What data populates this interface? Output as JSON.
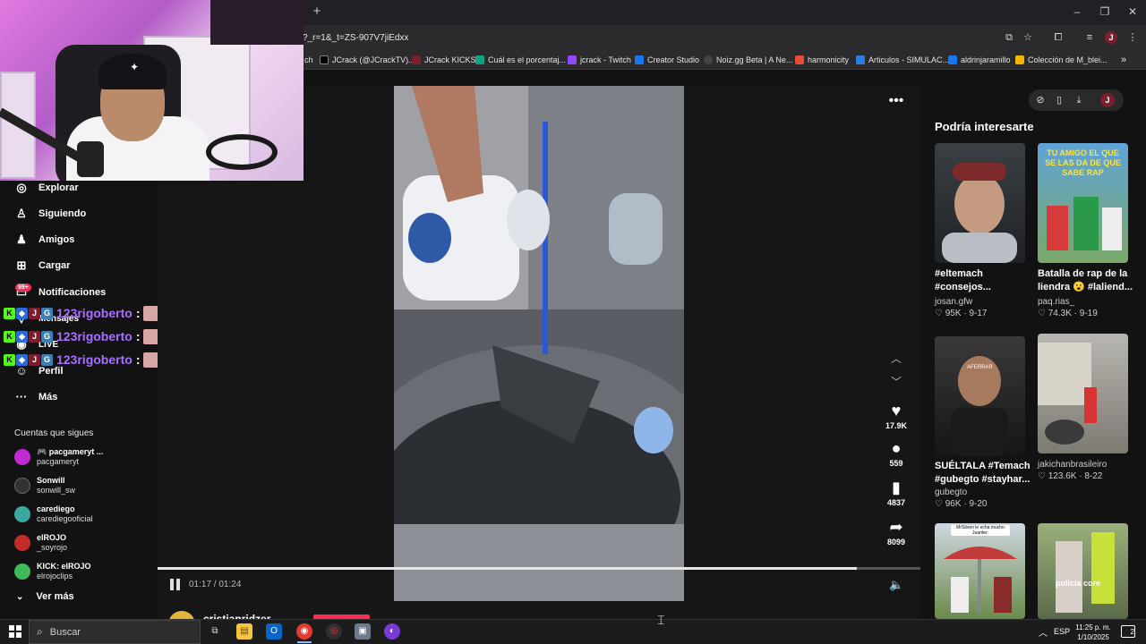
{
  "browser": {
    "new_tab": "+",
    "url": "?_r=1&_t=ZS-907V7jiEdxx",
    "window_controls": [
      "–",
      "❐",
      "✕"
    ],
    "bookmarks": [
      {
        "label": "ch",
        "color": "#000000"
      },
      {
        "label": "JCrack (@JCrackTV)...",
        "color": "#000000"
      },
      {
        "label": "JCrack KICKS",
        "color": "#7b1f2d"
      },
      {
        "label": "Cuál es el porcentaj...",
        "color": "#10a37f"
      },
      {
        "label": "jcrack - Twitch",
        "color": "#9146ff"
      },
      {
        "label": "Creator Studio",
        "color": "#1877f2"
      },
      {
        "label": "Noiz.gg Beta | A Ne...",
        "color": "#444444"
      },
      {
        "label": "harmonicity",
        "color": "#e94b35"
      },
      {
        "label": "Articulos - SIMULAC...",
        "color": "#2a7de1"
      },
      {
        "label": "aldrinjaramillo",
        "color": "#1877f2"
      },
      {
        "label": "Colección de M_blei...",
        "color": "#f4b400"
      }
    ]
  },
  "nav": {
    "items": [
      {
        "label": "Explorar",
        "icon": "compass-icon"
      },
      {
        "label": "Siguiendo",
        "icon": "following-icon"
      },
      {
        "label": "Amigos",
        "icon": "friends-icon"
      },
      {
        "label": "Cargar",
        "icon": "upload-icon"
      },
      {
        "label": "Notificaciones",
        "icon": "inbox-icon"
      },
      {
        "label": "Mensajes",
        "icon": "message-icon"
      },
      {
        "label": "LIVE",
        "icon": "live-icon"
      },
      {
        "label": "Perfil",
        "icon": "profile-icon"
      },
      {
        "label": "Más",
        "icon": "more-icon"
      }
    ],
    "notif_badge": "99+",
    "following_header": "Cuentas que sigues",
    "accounts": [
      {
        "name": "🎮 pacgameryt ...",
        "handle": "pacgameryt",
        "color": "#c22ad2"
      },
      {
        "name": "Sonwill",
        "handle": "sonwill_sw",
        "color": "#333333"
      },
      {
        "name": "carediego",
        "handle": "carediegooficial",
        "color": "#3aa7a0"
      },
      {
        "name": "elROJO",
        "handle": "_soyrojo",
        "color": "#c42b2b"
      },
      {
        "name": "KICK: elROJO",
        "handle": "elrojoclips",
        "color": "#3fb95a"
      }
    ],
    "see_more": "Ver más"
  },
  "chat": {
    "lines": [
      {
        "user": "123rigoberto",
        "colon": ":"
      },
      {
        "user": "123rigoberto",
        "colon": ":"
      },
      {
        "user": "123rigoberto",
        "colon": ":"
      }
    ]
  },
  "player": {
    "more": "•••",
    "likes": "17.9K",
    "comments": "559",
    "saves": "4837",
    "shares": "8099",
    "time": "01:17 / 01:24",
    "progress": 0.917,
    "author": "cristianridzer"
  },
  "suggest": {
    "title": "Podría interesarte",
    "items": [
      {
        "caption": "#eltemach #consejos...",
        "user": "josan.gfw",
        "likes": "95K",
        "date": "9-17"
      },
      {
        "caption": "Batalla de rap de la liendra 😮 #laliend...",
        "user": "paq.rias_",
        "likes": "74.3K",
        "date": "9-19"
      },
      {
        "caption": "SUÉLTALA #Temach #gubegto #stayhar...",
        "user": "gubegto",
        "likes": "96K",
        "date": "9-20"
      },
      {
        "caption": "",
        "user": "jakichanbrasileiro",
        "likes": "123.6K",
        "date": "8-22"
      }
    ],
    "thumb_texts": [
      "TU AMIGO EL QUE SE LAS DA DE QUE SABE RAP",
      "AFERRAR",
      "MrStiven le echa mucho Juanfer:",
      "policia core"
    ]
  },
  "taskbar": {
    "search": "Buscar",
    "lang": "ESP",
    "time": "11:25 p. m.",
    "date": "1/10/2025",
    "notif_count": "2"
  }
}
